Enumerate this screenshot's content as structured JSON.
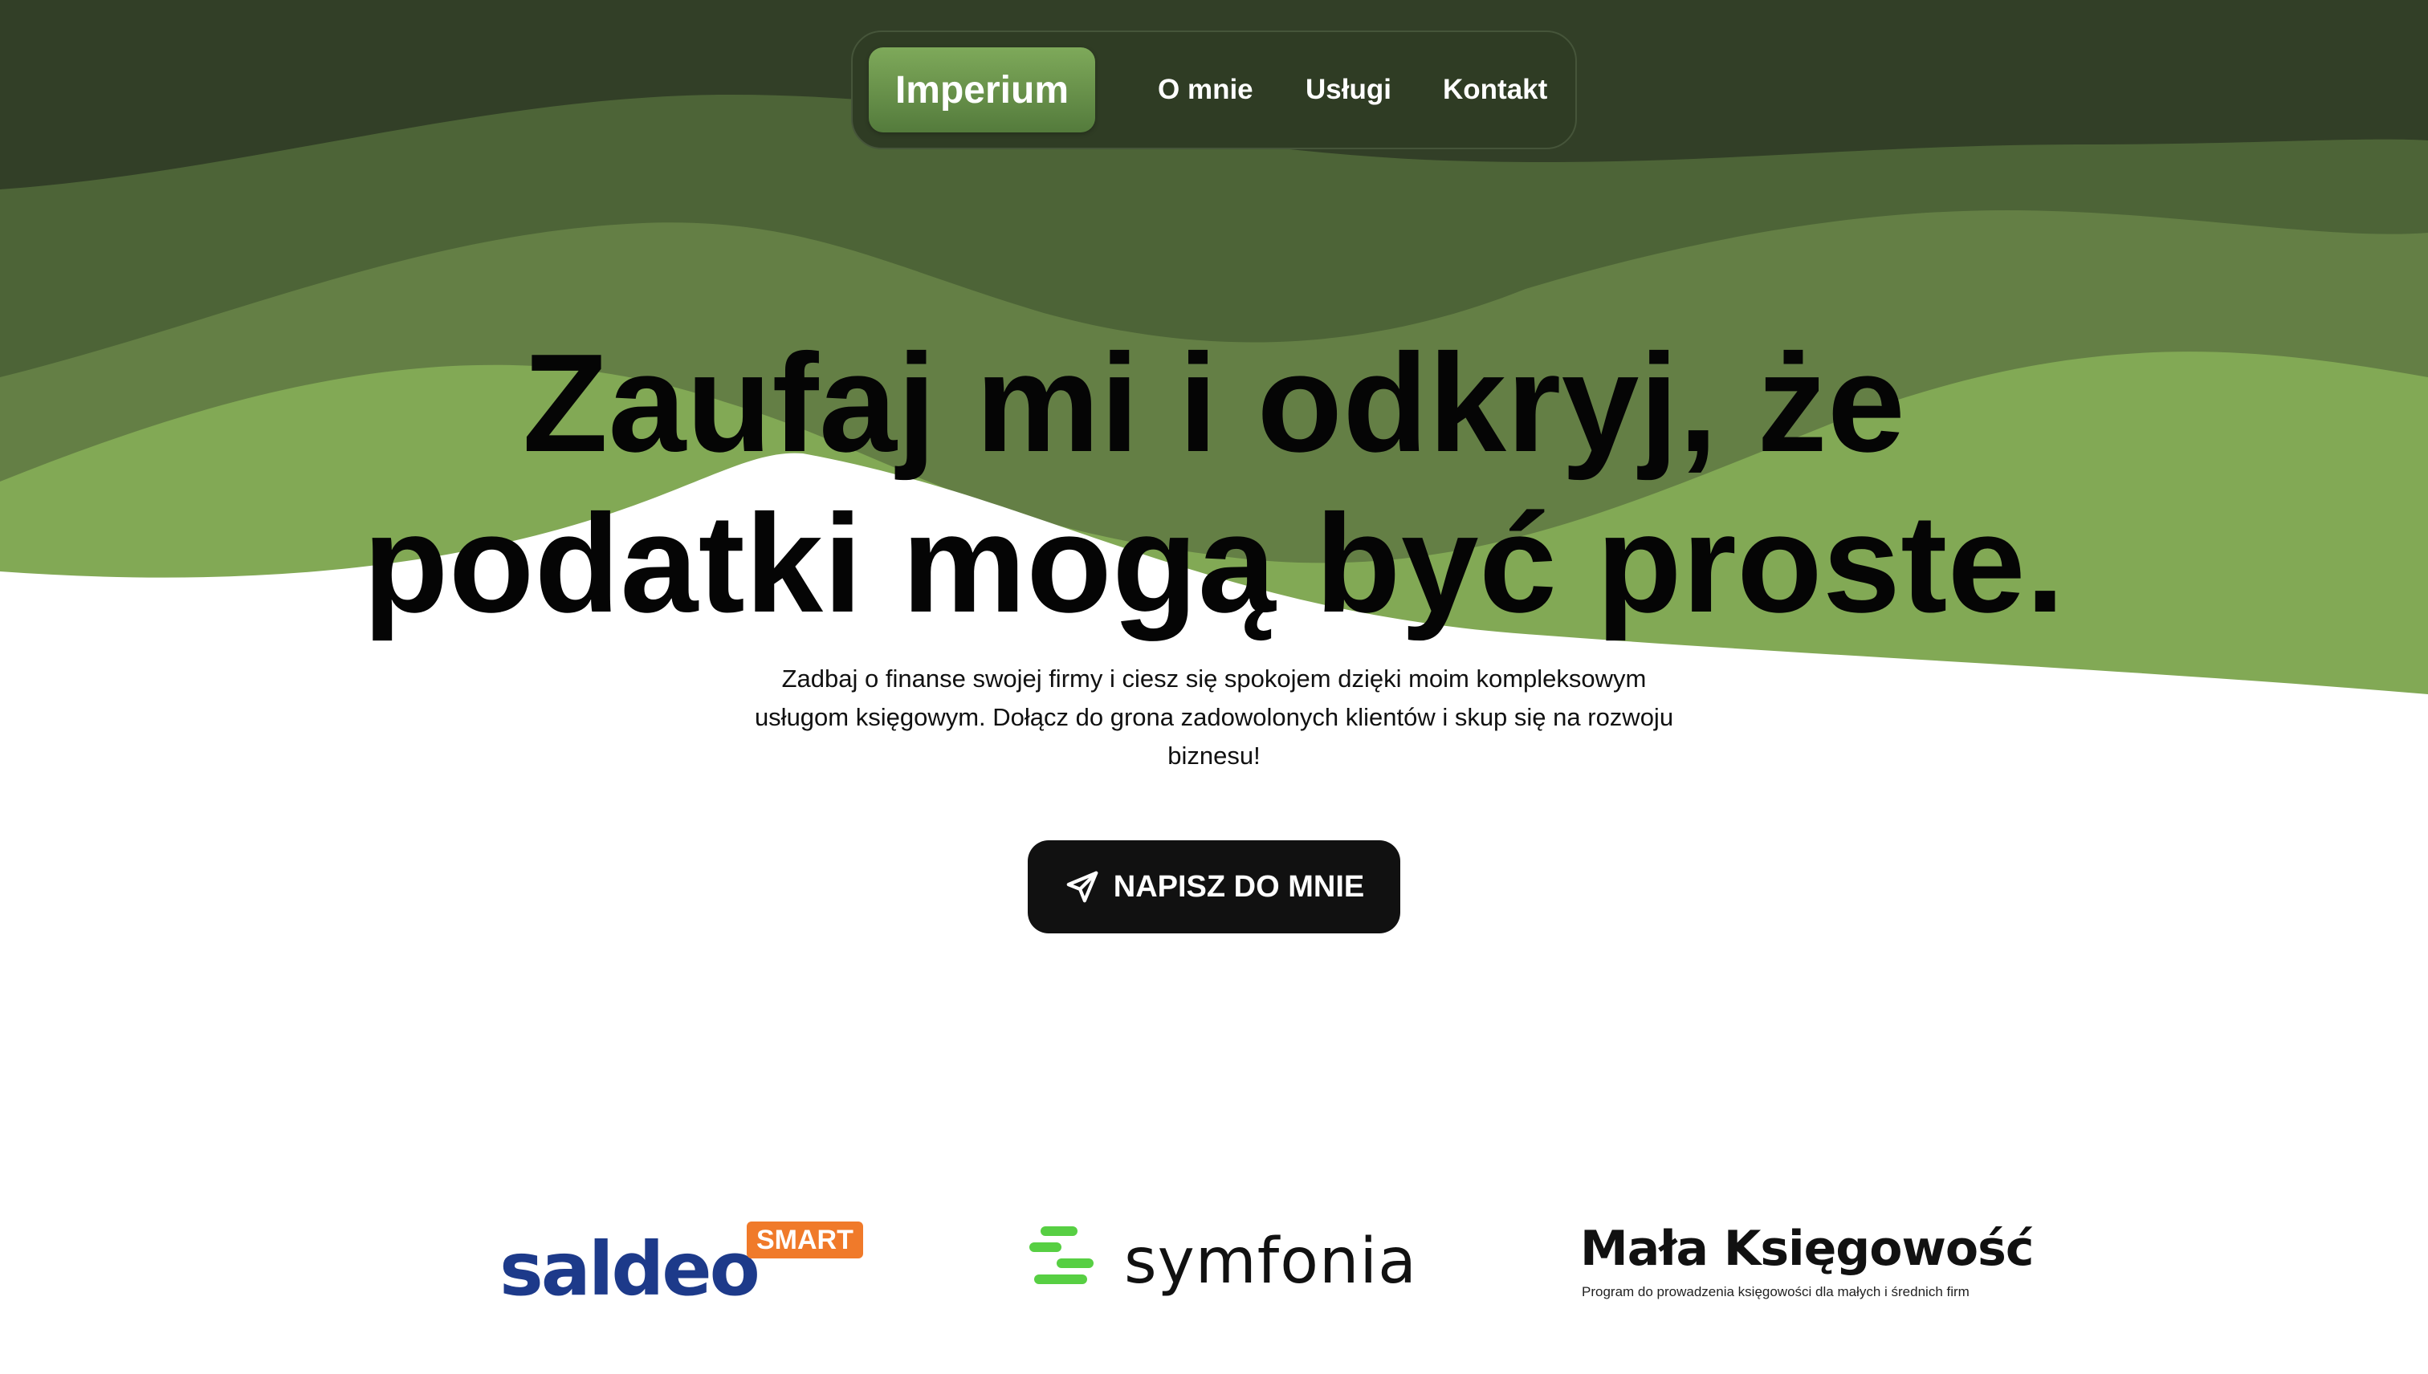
{
  "nav": {
    "brand": "Imperium",
    "links": [
      {
        "label": "O mnie"
      },
      {
        "label": "Usługi"
      },
      {
        "label": "Kontakt"
      }
    ]
  },
  "hero": {
    "title_line1": "Zaufaj mi i odkryj, że",
    "title_line2": "podatki mogą być proste.",
    "description": "Zadbaj o finanse swojej firmy i ciesz się spokojem dzięki moim kompleksowym usługom księgowym. Dołącz do grona zadowolonych klientów i skup się na rozwoju biznesu!",
    "cta_label": "NAPISZ DO MNIE",
    "cta_icon": "send-icon"
  },
  "partners": {
    "saldeo": {
      "word": "saldeo",
      "badge": "SMART"
    },
    "symfonia": {
      "word": "symfonia"
    },
    "mala": {
      "title": "Mała Księgowość",
      "subtitle": "Program do prowadzenia księgowości dla małych i średnich firm"
    }
  },
  "colors": {
    "wave_dark": "#323f27",
    "wave_mid_dark": "#4d6437",
    "wave_mid": "#647f45",
    "wave_light": "#82a955",
    "nav_bg": "#2f3c24",
    "cta_bg": "#111111",
    "saldeo_blue": "#1d3a8a",
    "saldeo_orange": "#f07a2a",
    "symfonia_green": "#57cf43"
  }
}
